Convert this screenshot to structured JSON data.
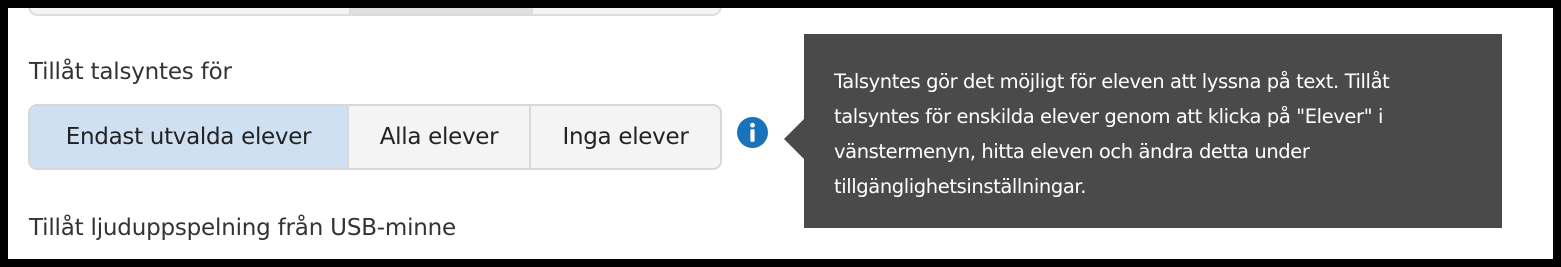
{
  "tts_setting": {
    "label": "Tillåt talsyntes för",
    "options": [
      {
        "label": "Endast utvalda elever",
        "selected": true
      },
      {
        "label": "Alla elever",
        "selected": false
      },
      {
        "label": "Inga elever",
        "selected": false
      }
    ],
    "info_icon": "info-circle-icon"
  },
  "tooltip": {
    "text": "Talsyntes gör det möjligt för eleven att lyssna på text. Tillåt talsyntes för enskilda elever genom att klicka på \"Elever\" i vänstermenyn, hitta eleven och ändra detta under tillgänglighetsinställningar."
  },
  "usb_setting": {
    "label": "Tillåt ljuduppspelning från USB-minne"
  },
  "colors": {
    "selected_option": "#cfe0f3",
    "info_icon": "#1a73b9",
    "tooltip_background": "#4a4a4a"
  }
}
